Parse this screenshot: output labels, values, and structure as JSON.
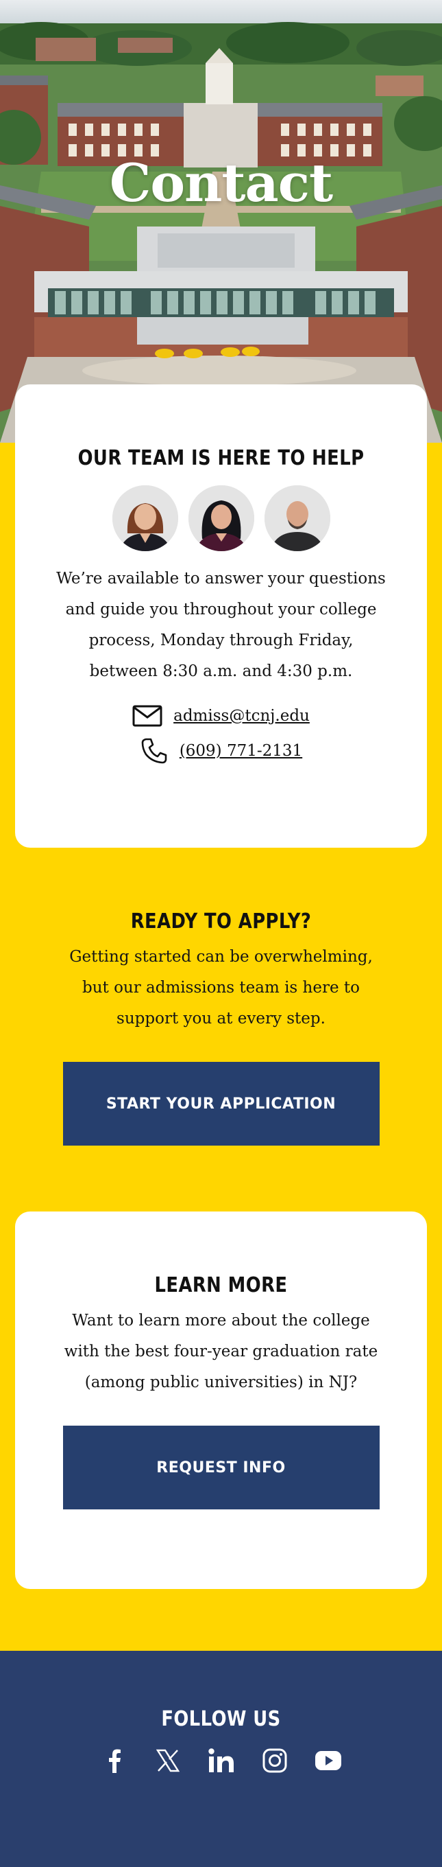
{
  "hero": {
    "title": "Contact"
  },
  "team": {
    "heading": "OUR TEAM IS HERE TO HELP",
    "avatars": [
      "staff-member-1",
      "staff-member-2",
      "staff-member-3"
    ],
    "description": "We’re available to answer your questions and guide you throughout your college process, Monday through Friday, between 8:30 a.m. and 4:30 p.m.",
    "email": "admiss@tcnj.edu",
    "email_icon": "envelope-icon",
    "phone": "(609) 771-2131",
    "phone_icon": "phone-icon"
  },
  "ready": {
    "heading": "READY TO APPLY?",
    "description": "Getting started can be overwhelming, but our admissions team is here to support you at every step.",
    "button_label": "START YOUR APPLICATION"
  },
  "learn": {
    "heading": "LEARN MORE",
    "description": "Want to learn more about the college with the best four-year graduation rate (among public universities) in NJ?",
    "button_label": "REQUEST INFO"
  },
  "footer": {
    "heading": "FOLLOW US",
    "socials": [
      "facebook-icon",
      "x-twitter-icon",
      "linkedin-icon",
      "instagram-icon",
      "youtube-icon"
    ]
  },
  "colors": {
    "page_background": "#ffd600",
    "card_background": "#ffffff",
    "button_background": "#263f6e",
    "footer_background": "#2a3f6d",
    "button_text": "#ffffff"
  }
}
